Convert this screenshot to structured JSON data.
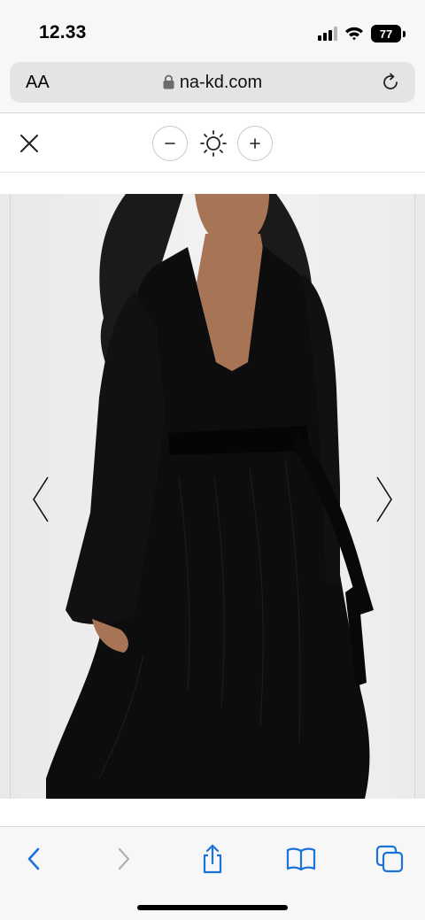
{
  "status_bar": {
    "time": "12.33",
    "battery_level": "77",
    "icons": [
      "cellular-signal-icon",
      "wifi-icon",
      "battery-icon"
    ]
  },
  "browser": {
    "text_size_label": "AA",
    "url": "na-kd.com",
    "icons": [
      "lock-icon",
      "reload-icon"
    ]
  },
  "image_viewer": {
    "icons": [
      "close-icon",
      "zoom-out-icon",
      "brightness-icon",
      "zoom-in-icon",
      "chevron-left-icon",
      "chevron-right-icon"
    ],
    "image_description_label": "Product photo"
  },
  "bottom_toolbar": {
    "icons": [
      "back-icon",
      "forward-icon",
      "share-icon",
      "bookmarks-icon",
      "tabs-icon"
    ]
  },
  "colors": {
    "accent": "#1a73d9",
    "disabled": "#b0b0b0",
    "chrome_bg": "#f7f7f7",
    "url_field": "#e4e4e6"
  }
}
